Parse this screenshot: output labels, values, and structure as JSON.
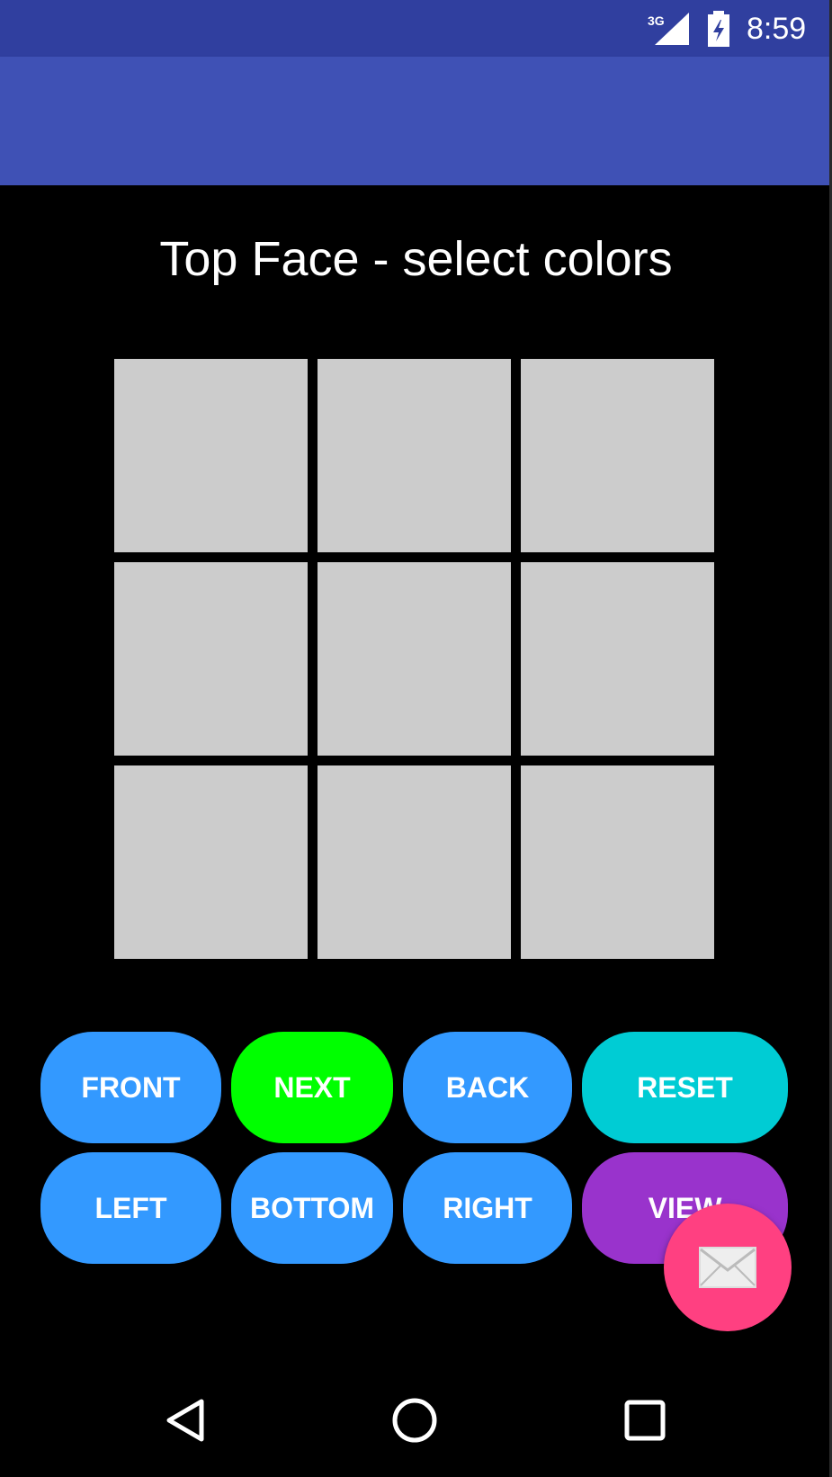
{
  "status_bar": {
    "time": "8:59",
    "network_label": "3G",
    "signal_icon": "cell-signal-icon",
    "battery_icon": "battery-charging-icon",
    "color": "#303F9F"
  },
  "app_bar": {
    "color": "#3F51B5"
  },
  "main": {
    "title": "Top Face - select colors",
    "grid": {
      "rows": 3,
      "cols": 3,
      "cell_color": "#CCCCCC"
    }
  },
  "buttons": {
    "front": "FRONT",
    "next": "NEXT",
    "back": "BACK",
    "reset": "RESET",
    "left": "LEFT",
    "bottom": "BOTTOM",
    "right": "RIGHT",
    "view": "VIEW"
  },
  "colors": {
    "blue": "#3399FF",
    "green": "#00FF00",
    "cyan": "#00CCD4",
    "purple": "#9933CC",
    "fab": "#FF4081"
  },
  "fab": {
    "icon": "email-icon"
  },
  "nav_bar": {
    "back_icon": "back-triangle-icon",
    "home_icon": "home-circle-icon",
    "recents_icon": "recents-square-icon"
  }
}
